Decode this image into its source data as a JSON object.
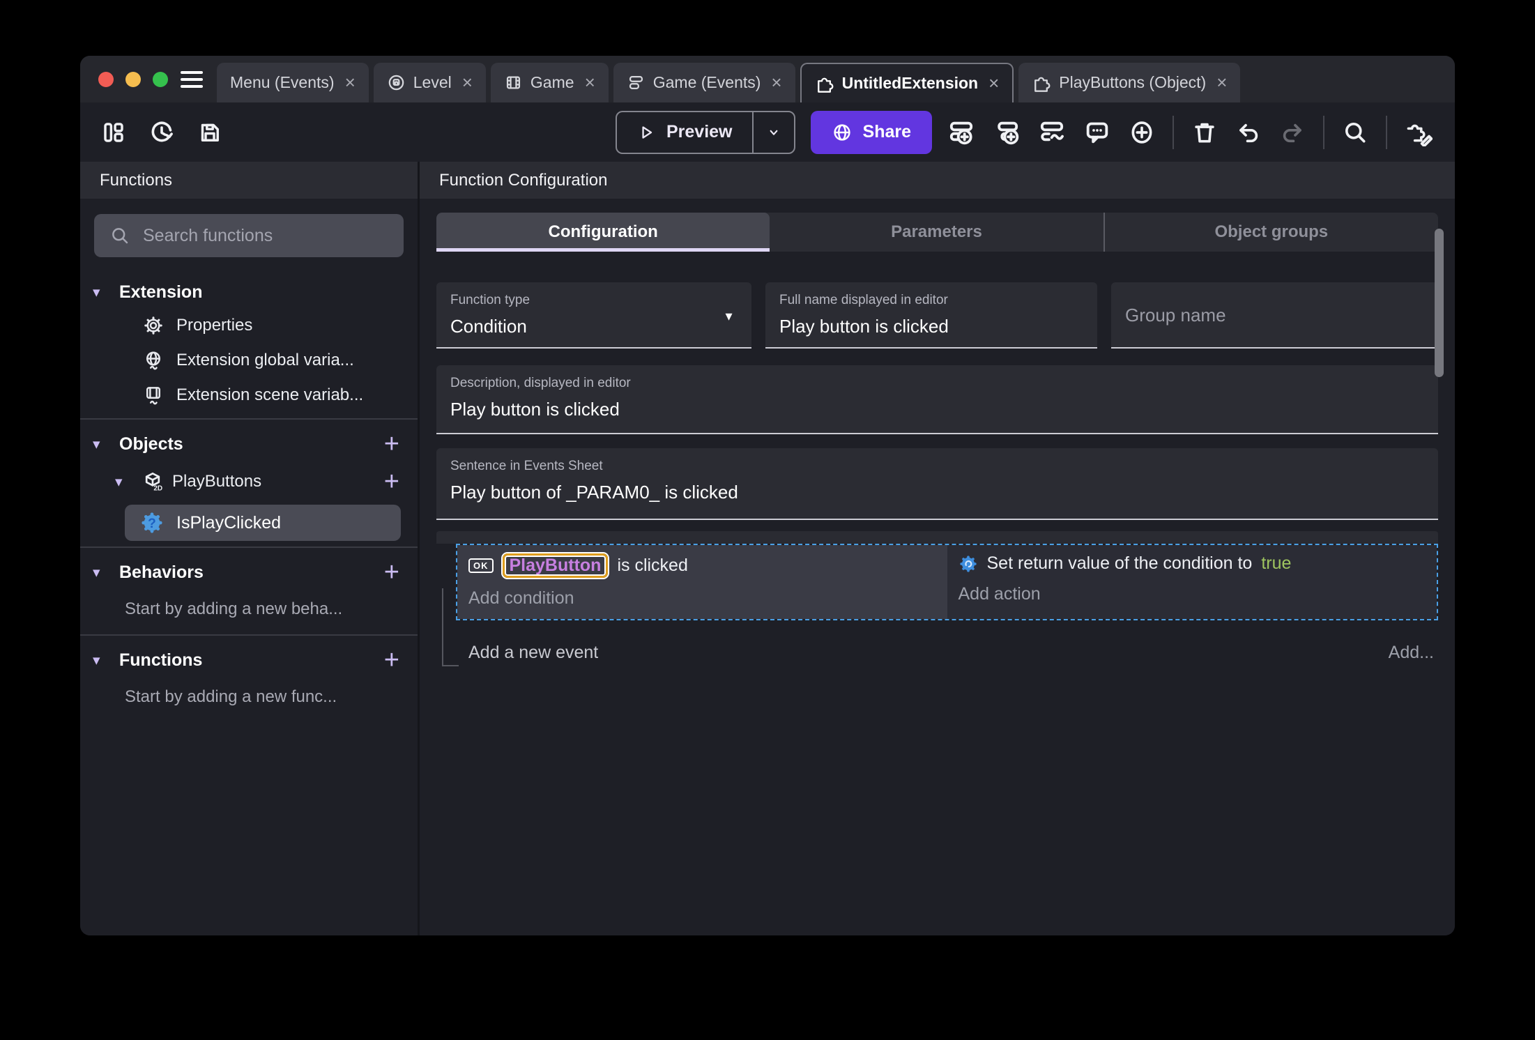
{
  "ui": {
    "close": "×",
    "caret_down": "▼",
    "triangle": "▾",
    "plus": "+"
  },
  "tabs": [
    {
      "label": "Menu (Events)"
    },
    {
      "label": "Level"
    },
    {
      "label": "Game"
    },
    {
      "label": "Game (Events)"
    },
    {
      "label": "UntitledExtension"
    },
    {
      "label": "PlayButtons (Object)"
    }
  ],
  "toolbar": {
    "preview": "Preview",
    "share": "Share"
  },
  "sidebar": {
    "header": "Functions",
    "search_placeholder": "Search functions",
    "extension": {
      "title": "Extension",
      "items": [
        "Properties",
        "Extension global varia...",
        "Extension scene variab..."
      ]
    },
    "objects": {
      "title": "Objects",
      "object_name": "PlayButtons",
      "function_name": "IsPlayClicked"
    },
    "behaviors": {
      "title": "Behaviors",
      "empty": "Start by adding a new beha..."
    },
    "functions": {
      "title": "Functions",
      "empty": "Start by adding a new func..."
    }
  },
  "main": {
    "header": "Function Configuration",
    "tabs": {
      "configuration": "Configuration",
      "parameters": "Parameters",
      "object_groups": "Object groups"
    },
    "fields": {
      "function_type": {
        "label": "Function type",
        "value": "Condition"
      },
      "full_name": {
        "label": "Full name displayed in editor",
        "value": "Play button is clicked"
      },
      "group_name": {
        "placeholder": "Group name"
      },
      "description": {
        "label": "Description, displayed in editor",
        "value": "Play button is clicked"
      },
      "sentence": {
        "label": "Sentence in Events Sheet",
        "value": "Play button of _PARAM0_ is clicked"
      }
    },
    "events": {
      "ok_badge": "OK",
      "condition_object": "PlayButton",
      "condition_text": "is clicked",
      "add_condition": "Add condition",
      "action_text": "Set return value of the condition to",
      "action_value": "true",
      "add_action": "Add action",
      "add_new_event": "Add a new event",
      "add_more": "Add..."
    }
  },
  "colors": {
    "share_purple": "#6236e0",
    "selection_blue": "#4aa0e6",
    "object_purple": "#c77fe0",
    "highlight_orange": "#dd9d1e",
    "boolean_green": "#9ec45f",
    "function_icon_blue": "#4d9be0",
    "accent_lavender": "#cbbcf2"
  }
}
